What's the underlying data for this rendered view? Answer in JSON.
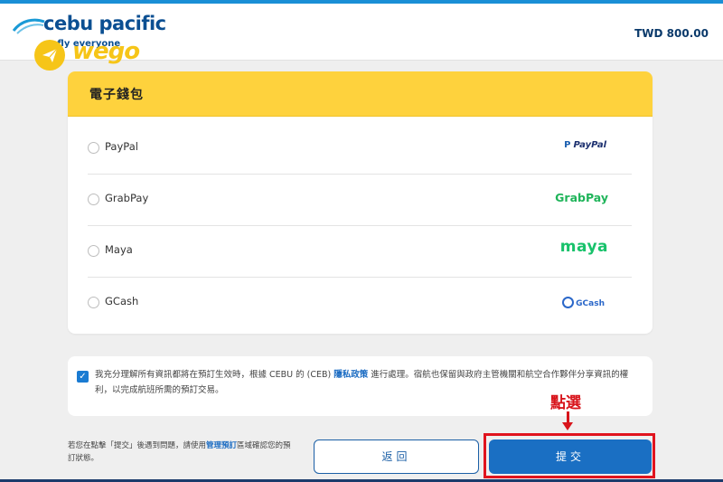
{
  "header": {
    "brand_name": "cebu pacific",
    "brand_tagline": "s fly everyone",
    "watermark": "wego",
    "price": "TWD 800.00"
  },
  "wallet": {
    "title": "電子錢包",
    "options": [
      {
        "label": "PayPal",
        "logo_text": "PayPal",
        "icon": "paypal-logo"
      },
      {
        "label": "GrabPay",
        "logo_text": "GrabPay",
        "icon": "grabpay-logo"
      },
      {
        "label": "Maya",
        "logo_text": "maya",
        "icon": "maya-logo"
      },
      {
        "label": "GCash",
        "logo_text": "GCash",
        "icon": "gcash-logo"
      }
    ]
  },
  "consent": {
    "checked": true,
    "text_before": "我充分理解所有資訊都將在預訂生效時，根據 CEBU 的 (CEB) ",
    "link": "隱私政策",
    "text_after": " 進行處理。宿航也保留與政府主管機關和航空合作夥伴分享資訊的權利，以完成航班所需的預訂交易。"
  },
  "help": {
    "text_before": "若您在點擊「提交」後遇到問題，請使用",
    "link": "管理預訂",
    "text_after": "區域確認您的預訂狀態。"
  },
  "buttons": {
    "back": "返回",
    "submit": "提交"
  },
  "annotation": {
    "label": "點選"
  },
  "colors": {
    "brand_blue": "#0b4f92",
    "wallet_header": "#fed23d",
    "submit": "#1a6fc3",
    "annotation_red": "#d8141b"
  }
}
